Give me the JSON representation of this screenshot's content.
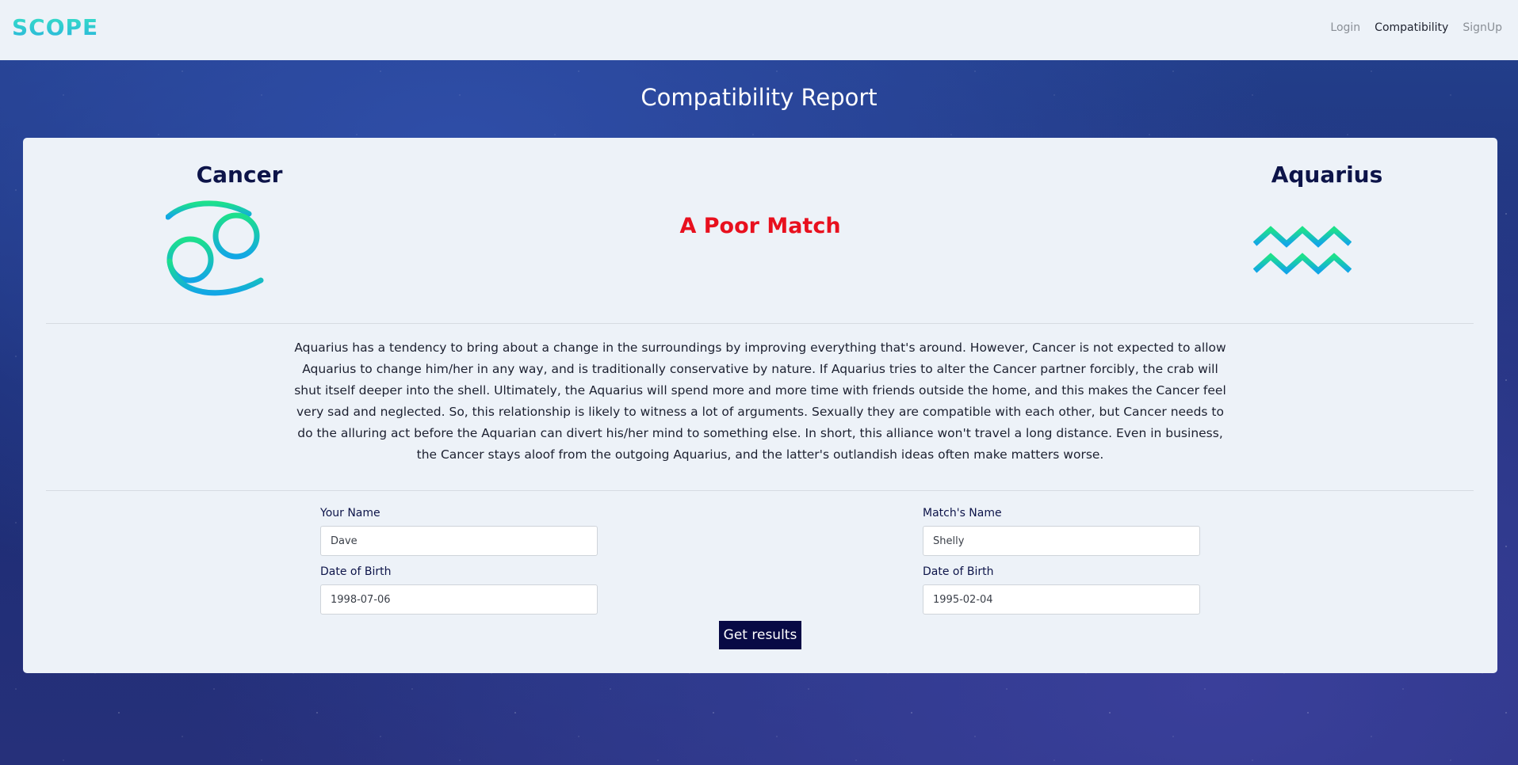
{
  "navbar": {
    "brand": "SCOPE",
    "links": [
      {
        "label": "Login",
        "active": false
      },
      {
        "label": "Compatibility",
        "active": true
      },
      {
        "label": "SignUp",
        "active": false
      }
    ]
  },
  "page_title": "Compatibility Report",
  "report": {
    "sign_left": {
      "name": "Cancer",
      "icon": "cancer-icon"
    },
    "sign_right": {
      "name": "Aquarius",
      "icon": "aquarius-icon"
    },
    "result": "A Poor Match",
    "description": "Aquarius has a tendency to bring about a change in the surroundings by improving everything that's around. However, Cancer is not expected to allow Aquarius to change him/her in any way, and is traditionally conservative by nature. If Aquarius tries to alter the Cancer partner forcibly, the crab will shut itself deeper into the shell. Ultimately, the Aquarius will spend more and more time with friends outside the home, and this makes the Cancer feel very sad and neglected. So, this relationship is likely to witness a lot of arguments. Sexually they are compatible with each other, but Cancer needs to do the alluring act before the Aquarian can divert his/her mind to something else. In short, this alliance won't travel a long distance. Even in business, the Cancer stays aloof from the outgoing Aquarius, and the latter's outlandish ideas often make matters worse."
  },
  "form": {
    "your_name_label": "Your Name",
    "your_name_value": "Dave",
    "your_dob_label": "Date of Birth",
    "your_dob_value": "1998-07-06",
    "match_name_label": "Match's Name",
    "match_name_value": "Shelly",
    "match_dob_label": "Date of Birth",
    "match_dob_value": "1995-02-04",
    "submit_label": "Get results"
  },
  "colors": {
    "accent_gradient_start": "#37e0c6",
    "accent_gradient_end": "#2ab5dc",
    "result_color": "#e8101e",
    "heading_color": "#0d1449",
    "button_bg": "#080a45"
  }
}
